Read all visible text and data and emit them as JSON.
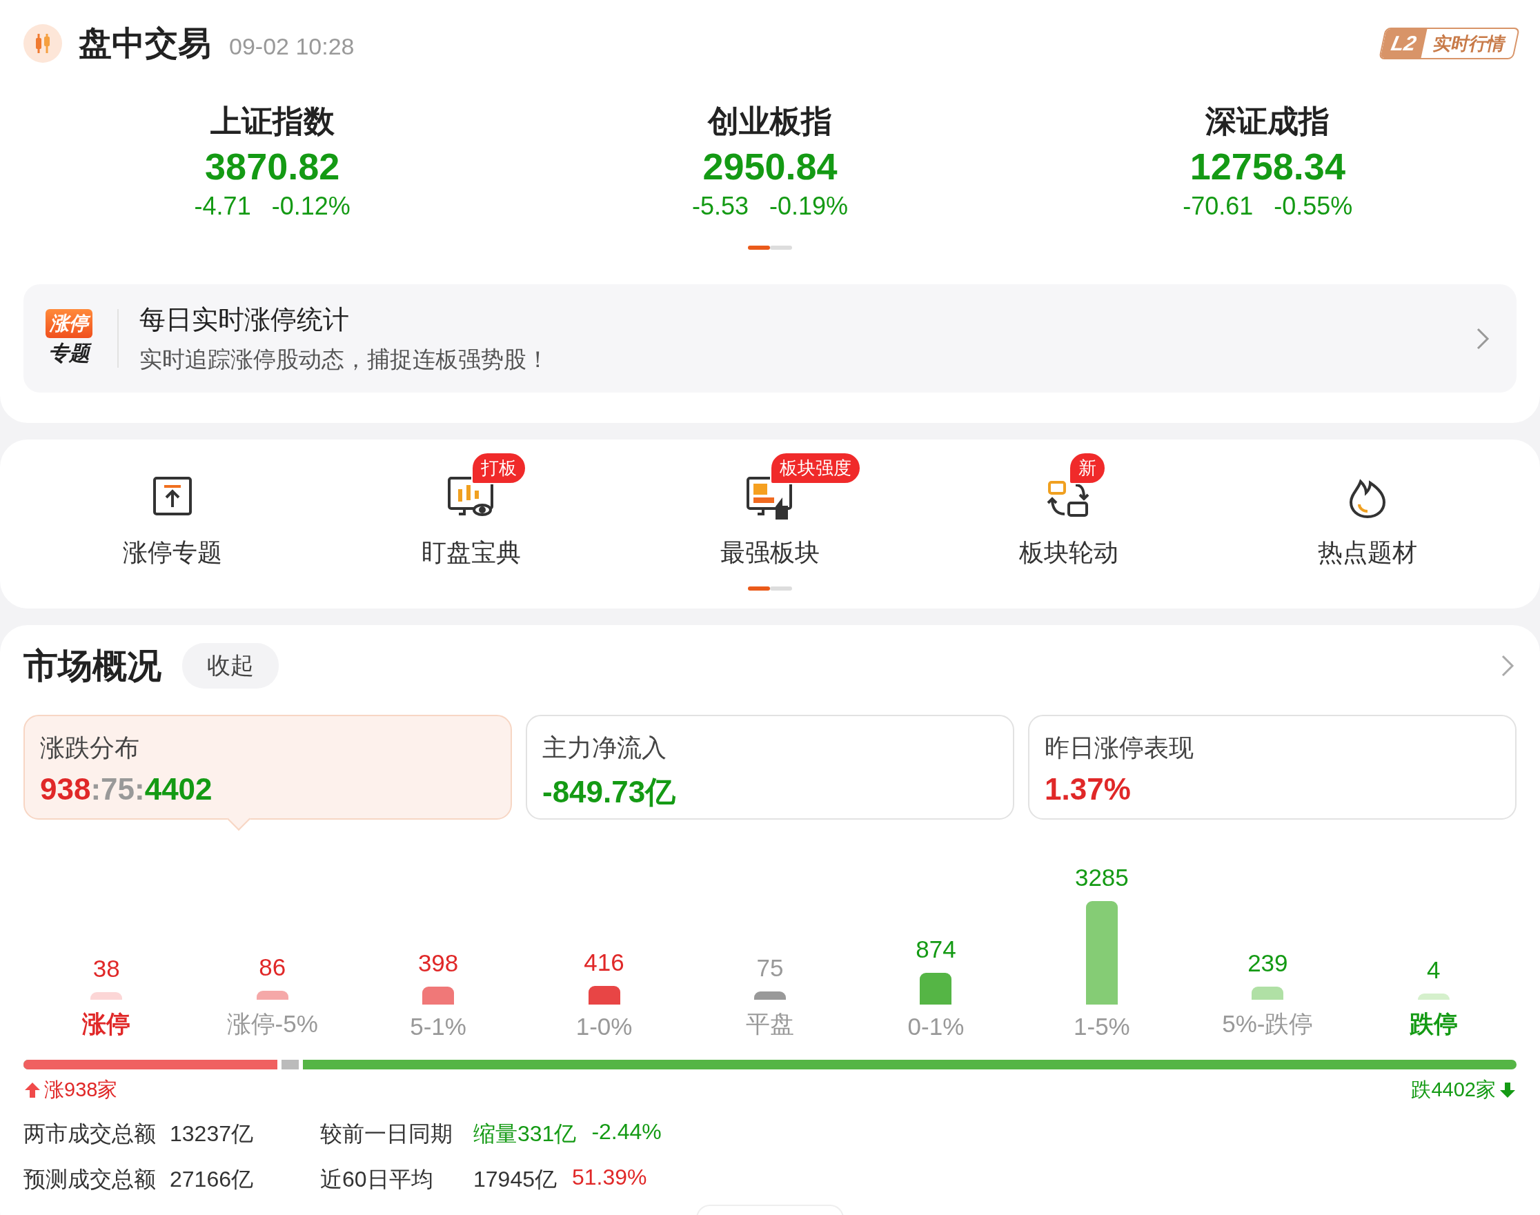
{
  "header": {
    "title": "盘中交易",
    "time": "09-02 10:28",
    "badge_level": "L2",
    "badge_text": "实时行情"
  },
  "indices": [
    {
      "name": "上证指数",
      "value": "3870.82",
      "change": "-4.71",
      "percent": "-0.12%",
      "rising": false
    },
    {
      "name": "创业板指",
      "value": "2950.84",
      "change": "-5.53",
      "percent": "-0.19%",
      "rising": false
    },
    {
      "name": "深证成指",
      "value": "12758.34",
      "change": "-70.61",
      "percent": "-0.55%",
      "rising": false
    }
  ],
  "index_pager": [
    {
      "selected": true
    },
    {
      "selected": false
    }
  ],
  "promo_banner": {
    "logo_top": "涨停",
    "logo_bottom": "专题",
    "title": "每日实时涨停统计",
    "subtitle": "实时追踪涨停股动态，捕捉连板强势股！"
  },
  "shortcuts": [
    {
      "label": "涨停专题",
      "kind": "board"
    },
    {
      "label": "盯盘宝典",
      "kind": "monitor-chart",
      "badge": "打板"
    },
    {
      "label": "最强板块",
      "kind": "monitor-thumb",
      "badge": "板块强度"
    },
    {
      "label": "板块轮动",
      "kind": "rotate",
      "badge": "新"
    },
    {
      "label": "热点题材",
      "kind": "flame"
    }
  ],
  "shortcut_pager": [
    {
      "selected": true
    },
    {
      "selected": false
    }
  ],
  "market": {
    "title": "市场概况",
    "collapse_button": "收起",
    "cards": [
      {
        "label": "涨跌分布",
        "selected": true,
        "parts": [
          {
            "text": "938",
            "color": "#e02828"
          },
          {
            "text": ":75:",
            "color": "#999999"
          },
          {
            "text": "4402",
            "color": "#149a14"
          }
        ]
      },
      {
        "label": "主力净流入",
        "selected": false,
        "parts": [
          {
            "text": "-849.73亿",
            "color": "#149a14"
          }
        ]
      },
      {
        "label": "昨日涨停表现",
        "selected": false,
        "parts": [
          {
            "text": "1.37%",
            "color": "#e02828"
          }
        ]
      }
    ]
  },
  "distribution": [
    {
      "count": {
        "text": "38",
        "color": "#e02828"
      },
      "bar": {
        "color": "#fcd6d6"
      },
      "label": {
        "text": "涨停",
        "bold": true
      }
    },
    {
      "count": {
        "text": "86",
        "color": "#e02828"
      },
      "bar": {
        "color": "#f5a8a8"
      },
      "label": {
        "text": "涨停-5%",
        "bold": false
      }
    },
    {
      "count": {
        "text": "398",
        "color": "#e02828"
      },
      "bar": {
        "color": "#f07878"
      },
      "label": {
        "text": "5-1%",
        "bold": false
      }
    },
    {
      "count": {
        "text": "416",
        "color": "#e02828"
      },
      "bar": {
        "color": "#e84545"
      },
      "label": {
        "text": "1-0%",
        "bold": false
      }
    },
    {
      "count": {
        "text": "75",
        "color": "#999999"
      },
      "bar": {
        "color": "#999999"
      },
      "label": {
        "text": "平盘",
        "bold": false
      }
    },
    {
      "count": {
        "text": "874",
        "color": "#149a14"
      },
      "bar": {
        "color": "#55b545"
      },
      "label": {
        "text": "0-1%",
        "bold": false
      }
    },
    {
      "count": {
        "text": "3285",
        "color": "#149a14"
      },
      "bar": {
        "color": "#85cc75"
      },
      "label": {
        "text": "1-5%",
        "bold": false
      }
    },
    {
      "count": {
        "text": "239",
        "color": "#149a14"
      },
      "bar": {
        "color": "#b0e0a5"
      },
      "label": {
        "text": "5%-跌停",
        "bold": false
      }
    },
    {
      "count": {
        "text": "4",
        "color": "#149a14"
      },
      "bar": {
        "color": "#d5f0cc"
      },
      "label": {
        "text": "跌停",
        "bold": true
      }
    }
  ],
  "breadth": {
    "rise_label": "涨938家",
    "fall_label": "跌4402家",
    "rise_fill": {
      "level": 0.173
    },
    "flat_fill": {
      "level": 0.187
    }
  },
  "turnover": [
    {
      "label": "两市成交总额",
      "value": "13237亿",
      "compare_label": "较前一日同期",
      "compare_parts": [
        {
          "text": "缩量331亿",
          "color": "#149a14"
        },
        {
          "text": "-2.44%",
          "color": "#149a14"
        }
      ]
    },
    {
      "label": "预测成交总额",
      "value": "27166亿",
      "compare_label": "近60日平均",
      "compare_parts": [
        {
          "text": "17945亿",
          "color": "#333333"
        },
        {
          "text": "51.39%",
          "color": "#e02828"
        }
      ]
    }
  ]
}
